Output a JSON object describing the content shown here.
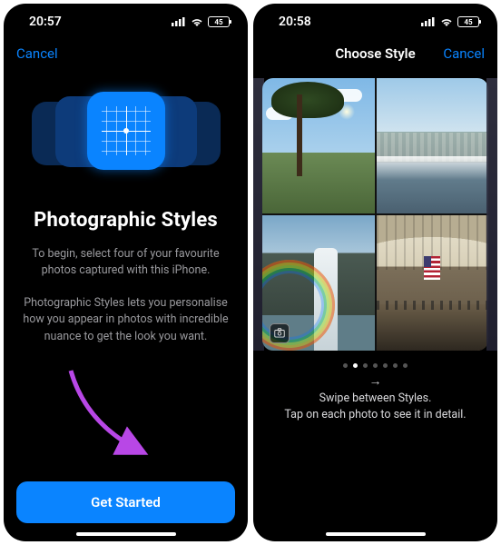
{
  "colors": {
    "accent": "#0a84ff",
    "bg": "#000000",
    "text_muted": "#9a9a9e"
  },
  "left": {
    "status": {
      "time": "20:57",
      "battery_pct": "45"
    },
    "nav": {
      "cancel": "Cancel"
    },
    "hero_icon": "styles-grid-icon",
    "title": "Photographic Styles",
    "para1": "To begin, select four of your favourite photos captured with this iPhone.",
    "para2": "Photographic Styles lets you personalise how you appear in photos with incredible nuance to get the look you want.",
    "primary_button": "Get Started"
  },
  "right": {
    "status": {
      "time": "20:58",
      "battery_pct": "45"
    },
    "nav": {
      "title": "Choose Style",
      "cancel": "Cancel"
    },
    "photos": [
      {
        "name": "tree-sky"
      },
      {
        "name": "niagara-wide"
      },
      {
        "name": "waterfall-rainbow"
      },
      {
        "name": "airport-hall"
      }
    ],
    "pager": {
      "count": 7,
      "active_index": 1
    },
    "swipe_glyph": "→",
    "hint_line1": "Swipe between Styles.",
    "hint_line2": "Tap on each photo to see it in detail."
  }
}
